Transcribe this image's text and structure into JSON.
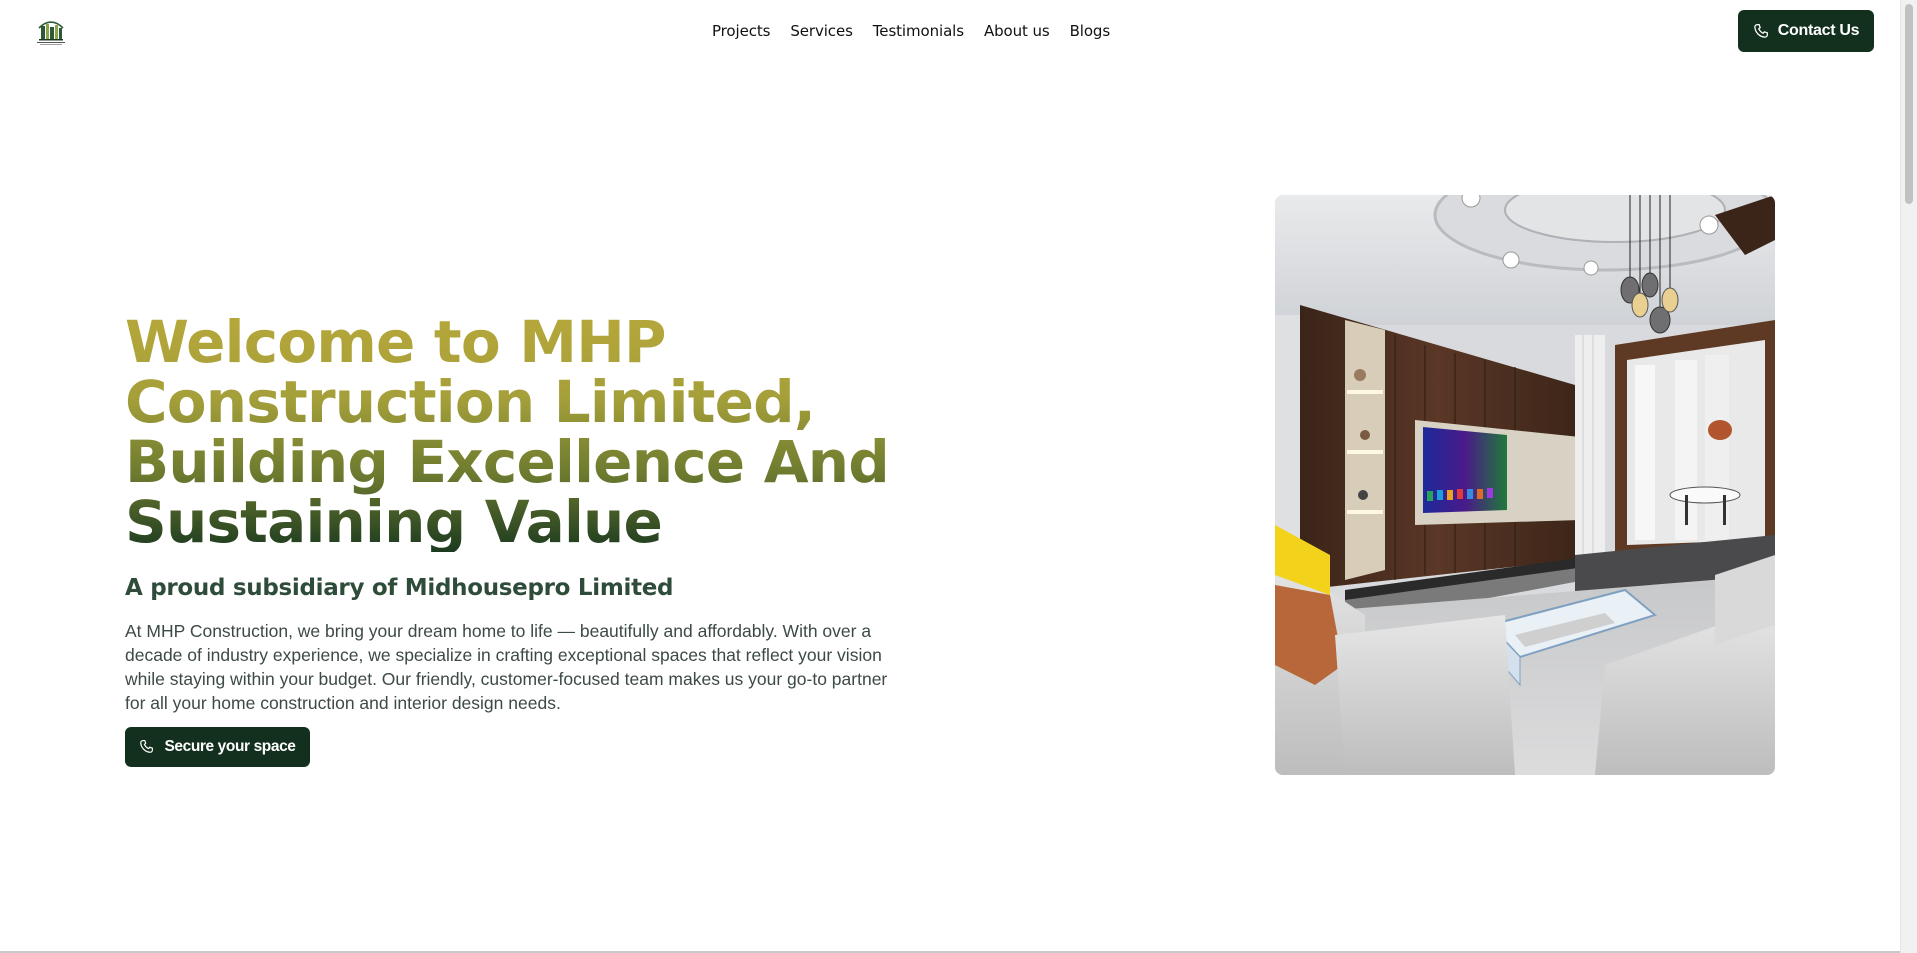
{
  "header": {
    "logo_icon": "mhp-construction-logo",
    "nav": [
      {
        "label": "Projects"
      },
      {
        "label": "Services"
      },
      {
        "label": "Testimonials"
      },
      {
        "label": "About us"
      },
      {
        "label": "Blogs"
      }
    ],
    "contact_label": "Contact Us",
    "contact_icon": "phone-icon"
  },
  "hero": {
    "title": "Welcome to MHP Construction Limited, Building Excellence And Sustaining Value",
    "subtitle": "A proud subsidiary of Midhousepro Limited",
    "intro": "At MHP Construction, we bring your dream home to life — beautifully and affordably. With over a decade of industry experience, we specialize in crafting exceptional spaces that reflect your vision while staying within your budget. Our friendly, customer-focused team makes us your go-to partner for all your home construction and interior design needs.",
    "cta_label": "Secure your space",
    "cta_icon": "phone-icon",
    "image": "living-room-interior-photo"
  },
  "colors": {
    "brand_dark": "#13301e",
    "title_gold": "#b6a73a",
    "title_dark": "#1b3a1f",
    "subtitle": "#2f4c3a",
    "body_text": "#3d4a44"
  }
}
